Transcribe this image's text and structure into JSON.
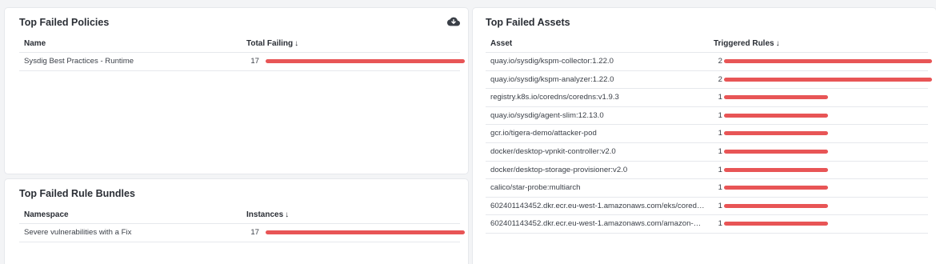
{
  "colors": {
    "bar": "#e85556",
    "panel": "#ffffff",
    "background": "#f3f4f6"
  },
  "policies": {
    "title": "Top Failed Policies",
    "download_icon": "cloud-download-icon",
    "columns": {
      "name": "Name",
      "value": "Total Failing",
      "sort": "↓"
    },
    "rows": [
      {
        "name": "Sysdig Best Practices - Runtime",
        "value": "17",
        "fraction": 1.0
      }
    ]
  },
  "bundles": {
    "title": "Top Failed Rule Bundles",
    "columns": {
      "name": "Namespace",
      "value": "Instances",
      "sort": "↓"
    },
    "rows": [
      {
        "name": "Severe vulnerabilities with a Fix",
        "value": "17",
        "fraction": 1.0
      }
    ]
  },
  "assets": {
    "title": "Top Failed Assets",
    "columns": {
      "name": "Asset",
      "value": "Triggered Rules",
      "sort": "↓"
    },
    "rows": [
      {
        "name": "quay.io/sysdig/kspm-collector:1.22.0",
        "value": "2",
        "fraction": 1.0
      },
      {
        "name": "quay.io/sysdig/kspm-analyzer:1.22.0",
        "value": "2",
        "fraction": 1.0
      },
      {
        "name": "registry.k8s.io/coredns/coredns:v1.9.3",
        "value": "1",
        "fraction": 0.5
      },
      {
        "name": "quay.io/sysdig/agent-slim:12.13.0",
        "value": "1",
        "fraction": 0.5
      },
      {
        "name": "gcr.io/tigera-demo/attacker-pod",
        "value": "1",
        "fraction": 0.5
      },
      {
        "name": "docker/desktop-vpnkit-controller:v2.0",
        "value": "1",
        "fraction": 0.5
      },
      {
        "name": "docker/desktop-storage-provisioner:v2.0",
        "value": "1",
        "fraction": 0.5
      },
      {
        "name": "calico/star-probe:multiarch",
        "value": "1",
        "fraction": 0.5
      },
      {
        "name": "602401143452.dkr.ecr.eu-west-1.amazonaws.com/eks/coredns:v...",
        "value": "1",
        "fraction": 0.5
      },
      {
        "name": "602401143452.dkr.ecr.eu-west-1.amazonaws.com/amazon-k8s-c...",
        "value": "1",
        "fraction": 0.5
      }
    ]
  }
}
